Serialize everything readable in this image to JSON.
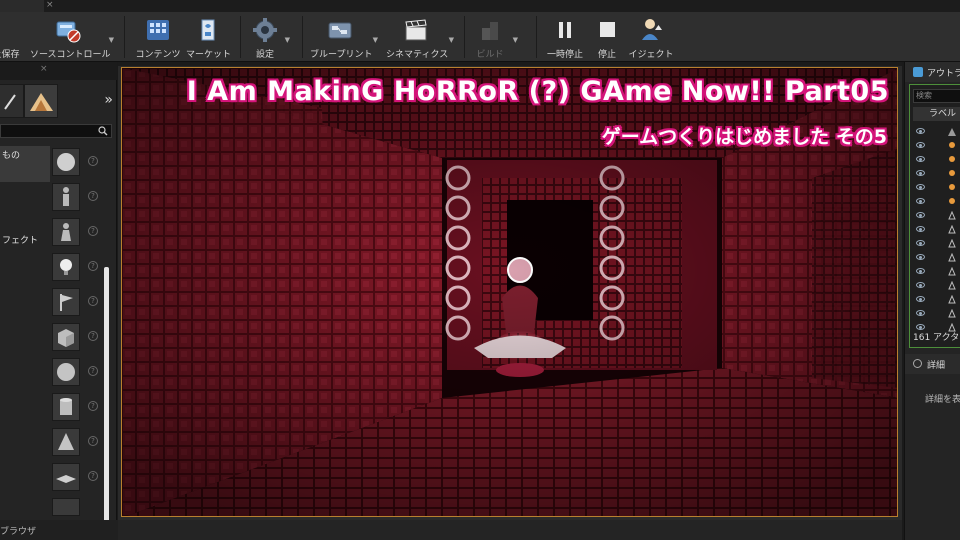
{
  "toolbar": {
    "buttons": [
      {
        "label": "上保存"
      },
      {
        "label": "ソースコントロール"
      },
      {
        "label": "コンテンツ"
      },
      {
        "label": "マーケット"
      },
      {
        "label": "設定"
      },
      {
        "label": "ブループリント"
      },
      {
        "label": "シネマティクス"
      },
      {
        "label": "ビルド"
      },
      {
        "label": "一時停止"
      },
      {
        "label": "停止"
      },
      {
        "label": "イジェクト"
      }
    ]
  },
  "left_panel": {
    "categories": [
      {
        "label": "もの"
      },
      {
        "label": "フェクト"
      }
    ],
    "more_label": "»",
    "bottom_tab": "ブラウザ",
    "help_mark": "?"
  },
  "viewport": {
    "title": "I Am MakinG HoRRoR (?) GAme Now!! Part05",
    "subtitle": "ゲームつくりはじめました その5"
  },
  "right_panel": {
    "outliner_title": "アウトラ",
    "search_placeholder": "検索",
    "label_header": "ラベル",
    "actor_count": "161 アクタ",
    "details_title": "詳細",
    "details_text": "詳細を表"
  }
}
